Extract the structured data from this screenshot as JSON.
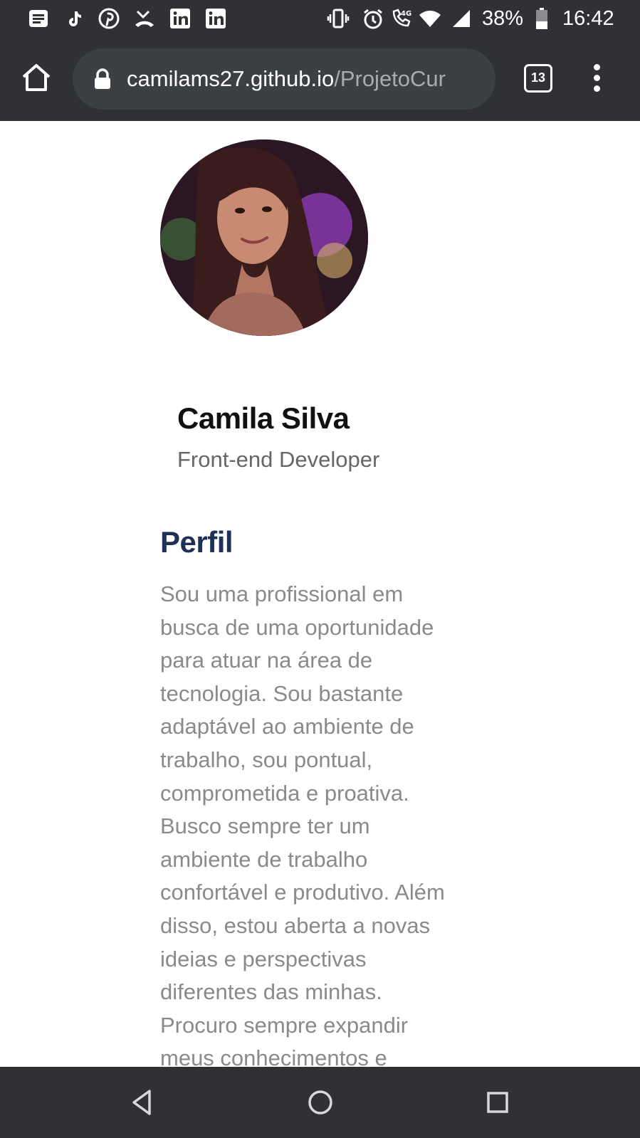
{
  "status_bar": {
    "battery_percent": "38%",
    "time": "16:42",
    "network_type": "4G",
    "icons": [
      "news-icon",
      "tiktok-icon",
      "pinterest-icon",
      "missed-call-icon",
      "linkedin-icon",
      "linkedin-icon",
      "vibrate-icon",
      "alarm-icon",
      "volte-call-icon",
      "wifi-icon",
      "cell-signal-icon",
      "battery-icon"
    ]
  },
  "browser": {
    "url_host": "camilams27.github.io",
    "url_path": "/ProjetoCur",
    "tab_count": "13",
    "icons": [
      "home-icon",
      "lock-icon",
      "tab-switcher-icon",
      "more-vert-icon"
    ]
  },
  "profile": {
    "name": "Camila Silva",
    "role": "Front-end Developer"
  },
  "perfil": {
    "title": "Perfil",
    "lines": [
      "Sou uma profissional em",
      "busca de uma oportunidade",
      "para atuar na área de",
      "tecnologia. Sou bastante",
      "adaptável ao ambiente de",
      "trabalho, sou pontual,",
      "comprometida e proativa.",
      "Busco sempre ter um",
      "ambiente de trabalho",
      "confortável e produtivo. Além",
      "disso, estou aberta a novas",
      "ideias e perspectivas",
      "diferentes das minhas.",
      "Procuro sempre expandir",
      "meus conhecimentos e"
    ]
  },
  "nav_bar": {
    "icons": [
      "back-icon",
      "home-circle-icon",
      "recents-icon"
    ]
  },
  "colors": {
    "chrome": "#2f3135",
    "url_pill": "#3c3f44",
    "heading_accent": "#1f3056",
    "body_text": "#8a8a8a"
  }
}
